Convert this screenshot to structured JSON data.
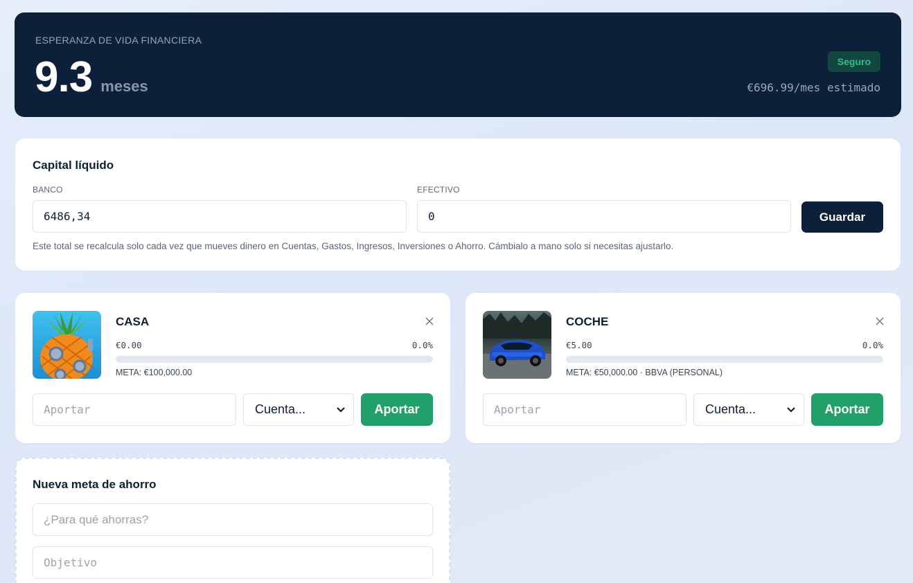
{
  "hero": {
    "label": "ESPERANZA DE VIDA FINANCIERA",
    "value": "9.3",
    "unit": "meses",
    "badge": "Seguro",
    "monthly": "€696.99/mes estimado"
  },
  "capital": {
    "title": "Capital líquido",
    "bank_label": "BANCO",
    "bank_value": "6486,34",
    "cash_label": "EFECTIVO",
    "cash_value": "0",
    "save_label": "Guardar",
    "help": "Este total se recalcula solo cada vez que mueves dinero en Cuentas, Gastos, Ingresos, Inversiones o Ahorro. Cámbialo a mano solo si necesitas ajustarlo."
  },
  "goals": [
    {
      "name": "CASA",
      "amount": "€0.00",
      "percent": "0.0%",
      "progress": 0,
      "meta": "META: €100,000.00",
      "contribute_placeholder": "Aportar",
      "account_select": "Cuenta...",
      "contribute_button": "Aportar",
      "image_icon": "pineapple-house-image"
    },
    {
      "name": "COCHE",
      "amount": "€5.00",
      "percent": "0.0%",
      "progress": 0.0001,
      "meta": "META: €50,000.00 · BBVA (PERSONAL)",
      "contribute_placeholder": "Aportar",
      "account_select": "Cuenta...",
      "contribute_button": "Aportar",
      "image_icon": "blue-car-image"
    }
  ],
  "new_goal": {
    "title": "Nueva meta de ahorro",
    "purpose_placeholder": "¿Para qué ahorras?",
    "target_placeholder": "Objetivo"
  },
  "colors": {
    "navy": "#0c2039",
    "green": "#22a06b",
    "badge_bg": "#11473e",
    "badge_text": "#2fbf85"
  }
}
